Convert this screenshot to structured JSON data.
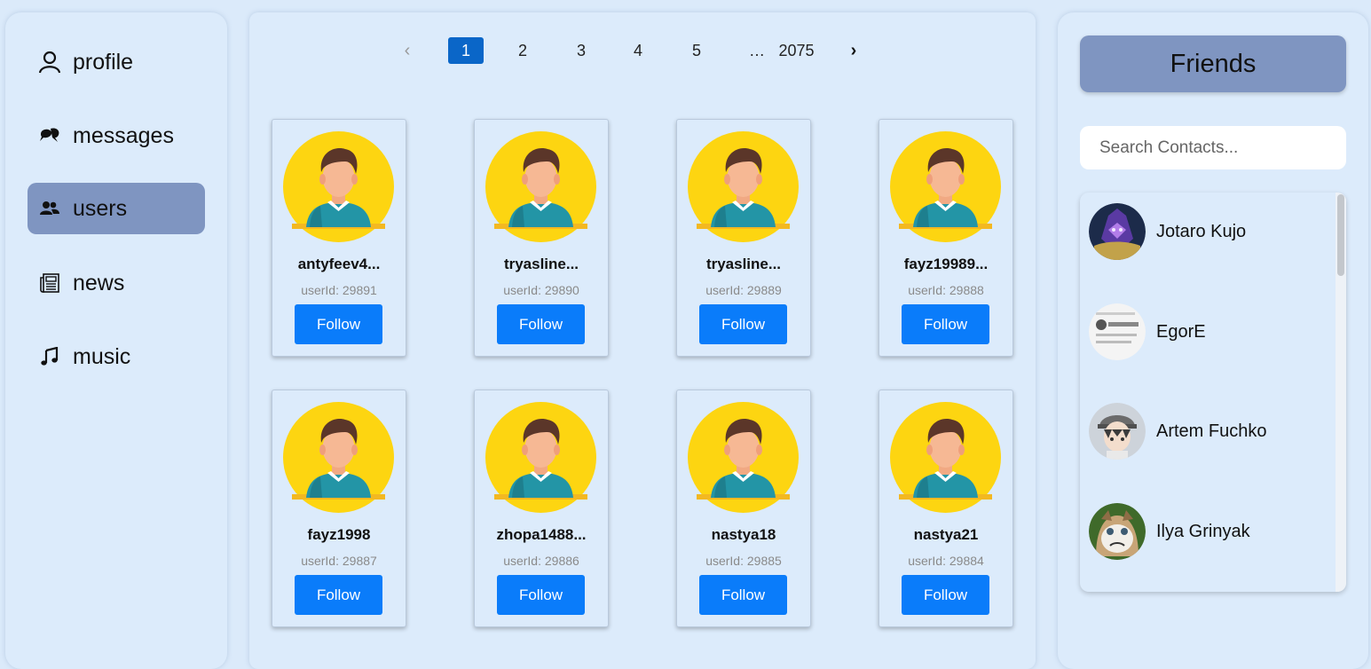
{
  "sidebar": {
    "items": [
      {
        "label": "profile",
        "icon": "user-icon",
        "active": false
      },
      {
        "label": "messages",
        "icon": "chat-bubbles-icon",
        "active": false
      },
      {
        "label": "users",
        "icon": "users-icon",
        "active": true
      },
      {
        "label": "news",
        "icon": "newspaper-icon",
        "active": false
      },
      {
        "label": "music",
        "icon": "music-note-icon",
        "active": false
      }
    ]
  },
  "pagination": {
    "prev": "‹",
    "pages": [
      "1",
      "2",
      "3",
      "4",
      "5"
    ],
    "current": "1",
    "ellipsis": "…",
    "last": "2075",
    "next": "›"
  },
  "users": [
    {
      "name": "antyfeev4...",
      "id": "userId: 29891",
      "button": "Follow"
    },
    {
      "name": "tryasline...",
      "id": "userId: 29890",
      "button": "Follow"
    },
    {
      "name": "tryasline...",
      "id": "userId: 29889",
      "button": "Follow"
    },
    {
      "name": "fayz19989...",
      "id": "userId: 29888",
      "button": "Follow"
    },
    {
      "name": "fayz1998",
      "id": "userId: 29887",
      "button": "Follow"
    },
    {
      "name": "zhopa1488...",
      "id": "userId: 29886",
      "button": "Follow"
    },
    {
      "name": "nastya18",
      "id": "userId: 29885",
      "button": "Follow"
    },
    {
      "name": "nastya21",
      "id": "userId: 29884",
      "button": "Follow"
    }
  ],
  "friends": {
    "title": "Friends",
    "search_placeholder": "Search Contacts...",
    "contacts": [
      {
        "name": "Jotaro Kujo"
      },
      {
        "name": "EgorE"
      },
      {
        "name": "Artem Fuchko"
      },
      {
        "name": "Ilya Grinyak"
      }
    ]
  },
  "colors": {
    "page_bg": "#dbeafa",
    "active_nav": "#7f95c1",
    "follow_button": "#0a7cfa",
    "current_page": "#0a66c8"
  }
}
